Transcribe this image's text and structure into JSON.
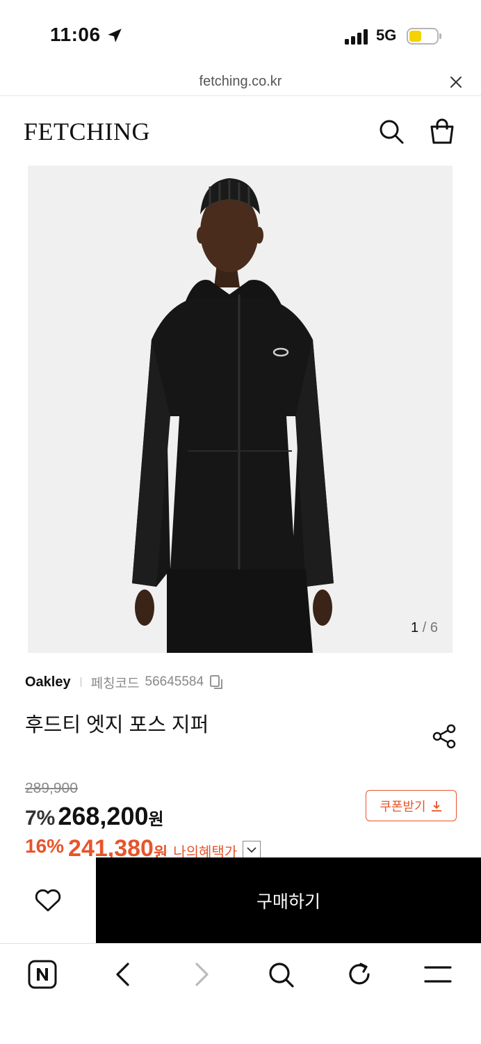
{
  "status_bar": {
    "time": "11:06",
    "network": "5G"
  },
  "url_bar": {
    "url": "fetching.co.kr"
  },
  "header": {
    "logo": "FETCHING"
  },
  "gallery": {
    "current": "1",
    "separator": "/",
    "total": "6"
  },
  "product": {
    "brand": "Oakley",
    "code_label": "페칭코드",
    "code": "56645584",
    "name": "후드티 엣지 포스 지퍼"
  },
  "price": {
    "original": "289,900",
    "discount_rate": "7%",
    "sale_price": "268,200",
    "unit": "원",
    "member_rate": "16%",
    "member_price": "241,380",
    "member_unit": "원",
    "benefit_label": "나의혜택가",
    "coupon_label": "쿠폰받기"
  },
  "actions": {
    "buy_label": "구매하기"
  },
  "colors": {
    "accent": "#e8542a",
    "buy_bg": "#000000"
  },
  "icons": [
    "location-arrow-icon",
    "signal-icon",
    "battery-icon",
    "close-icon",
    "search-icon",
    "shopping-bag-icon",
    "copy-icon",
    "share-icon",
    "download-icon",
    "chevron-down-icon",
    "heart-icon",
    "naver-icon",
    "back-icon",
    "forward-icon",
    "refresh-icon",
    "menu-icon"
  ]
}
